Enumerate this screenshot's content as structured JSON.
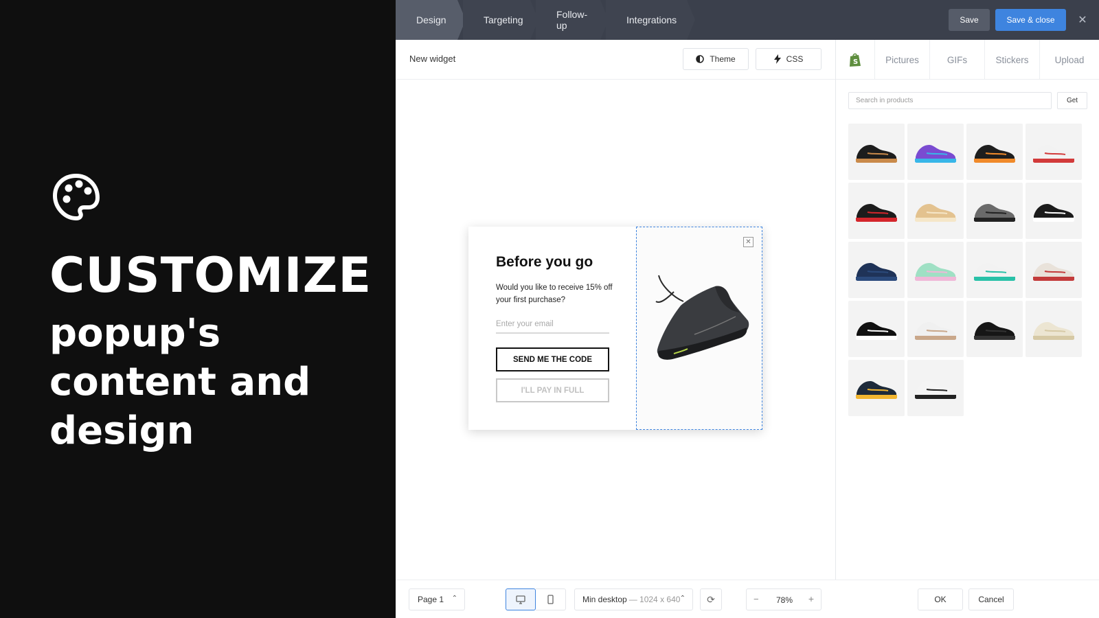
{
  "promo": {
    "headline": "CUSTOMIZE",
    "subline": "popup's content and design",
    "icon": "palette-icon"
  },
  "topbar": {
    "tabs": [
      {
        "label": "Design",
        "active": true
      },
      {
        "label": "Targeting"
      },
      {
        "label": "Follow-up"
      },
      {
        "label": "Integrations"
      }
    ],
    "save_label": "Save",
    "save_close_label": "Save & close",
    "close_icon": "close-icon"
  },
  "canvas": {
    "widget_title": "New widget",
    "theme_label": "Theme",
    "css_label": "CSS"
  },
  "popup": {
    "title": "Before you go",
    "body": "Would you like to receive 15% off your first purchase?",
    "email_placeholder": "Enter your email",
    "send_label": "SEND ME THE CODE",
    "pay_label": "I'LL PAY IN FULL"
  },
  "bottombar": {
    "page_label": "Page 1",
    "size_label": "Min desktop",
    "size_dim": "— 1024 x 640",
    "zoom": "78%",
    "ok_label": "OK",
    "cancel_label": "Cancel"
  },
  "assets": {
    "tabs": [
      "Pictures",
      "GIFs",
      "Stickers",
      "Upload"
    ],
    "search_placeholder": "Search in products",
    "get_label": "Get",
    "products": [
      {
        "shoe": "black-gum-sneaker"
      },
      {
        "shoe": "purple-blue-sneaker"
      },
      {
        "shoe": "black-orange-trainer"
      },
      {
        "shoe": "white-red-runner"
      },
      {
        "shoe": "black-red-high-top"
      },
      {
        "shoe": "tan-runner"
      },
      {
        "shoe": "grey-black-runner"
      },
      {
        "shoe": "black-white-high-top"
      },
      {
        "shoe": "navy-runner"
      },
      {
        "shoe": "mint-pastel-runner"
      },
      {
        "shoe": "white-teal-high-top"
      },
      {
        "shoe": "white-red-runner-2"
      },
      {
        "shoe": "black-white-low-top"
      },
      {
        "shoe": "white-floral-low-top"
      },
      {
        "shoe": "black-low-top"
      },
      {
        "shoe": "cream-runner"
      },
      {
        "shoe": "black-yellow-low-top"
      },
      {
        "shoe": "white-black-uptempo"
      }
    ]
  },
  "colors": {
    "topbar_bg": "#3b404c",
    "accent": "#3e84df",
    "promo_bg": "#0f0f0f"
  }
}
